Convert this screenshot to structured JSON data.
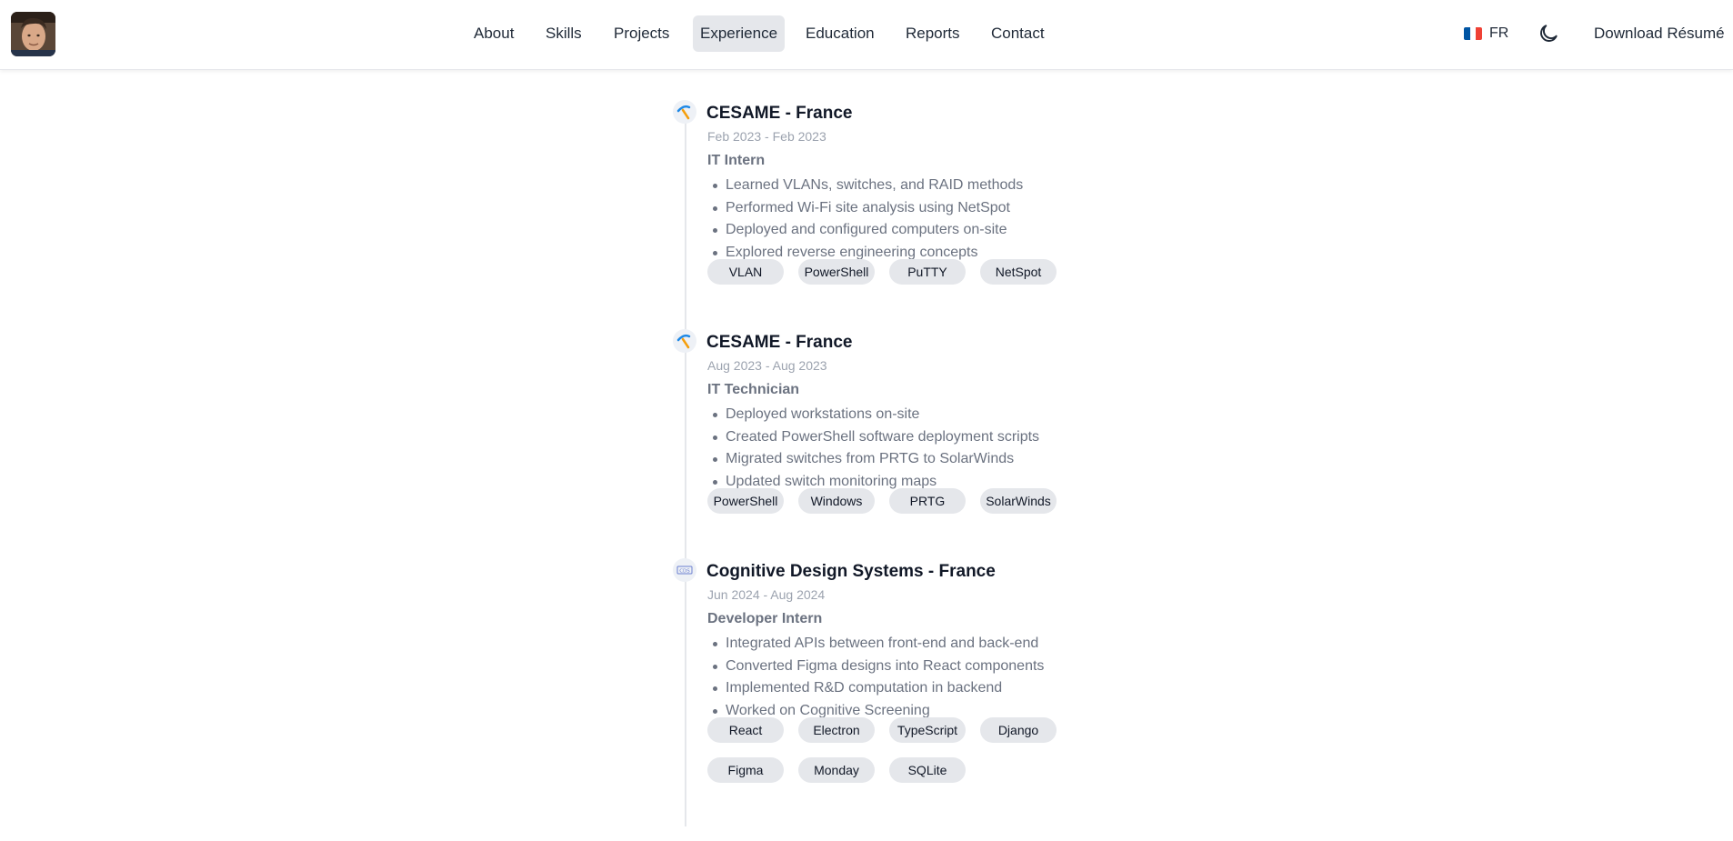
{
  "header": {
    "nav": [
      {
        "label": "About"
      },
      {
        "label": "Skills"
      },
      {
        "label": "Projects"
      },
      {
        "label": "Experience"
      },
      {
        "label": "Education"
      },
      {
        "label": "Reports"
      },
      {
        "label": "Contact"
      }
    ],
    "active_nav": "Experience",
    "language_label": "FR",
    "download_label": "Download Résumé"
  },
  "experience": [
    {
      "company": "CESAME - France",
      "dates": "Feb 2023 - Feb 2023",
      "role": "IT Intern",
      "bullets": [
        "Learned VLANs, switches, and RAID methods",
        "Performed Wi-Fi site analysis using NetSpot",
        "Deployed and configured computers on-site",
        "Explored reverse engineering concepts"
      ],
      "tags": [
        "VLAN",
        "PowerShell",
        "PuTTY",
        "NetSpot"
      ]
    },
    {
      "company": "CESAME - France",
      "dates": "Aug 2023 - Aug 2023",
      "role": "IT Technician",
      "bullets": [
        "Deployed workstations on-site",
        "Created PowerShell software deployment scripts",
        "Migrated switches from PRTG to SolarWinds",
        "Updated switch monitoring maps"
      ],
      "tags": [
        "PowerShell",
        "Windows",
        "PRTG",
        "SolarWinds"
      ]
    },
    {
      "company": "Cognitive Design Systems - France",
      "dates": "Jun 2024 - Aug 2024",
      "role": "Developer Intern",
      "bullets": [
        "Integrated APIs between front-end and back-end",
        "Converted Figma designs into React components",
        "Implemented R&D computation in backend",
        "Worked on Cognitive Screening"
      ],
      "tags": [
        "React",
        "Electron",
        "TypeScript",
        "Django",
        "Figma",
        "Monday",
        "SQLite"
      ]
    }
  ],
  "colors": {
    "active_nav_bg": "#e5e7eb",
    "tag_bg": "#e5e7eb",
    "muted_text": "#6b7280",
    "date_text": "#9ca3af"
  },
  "icons": {
    "avatar": "profile-photo",
    "language": "french-flag-icon",
    "theme": "moon-icon",
    "company_logos": [
      "cesame-logo",
      "cesame-logo",
      "cds-logo"
    ]
  }
}
